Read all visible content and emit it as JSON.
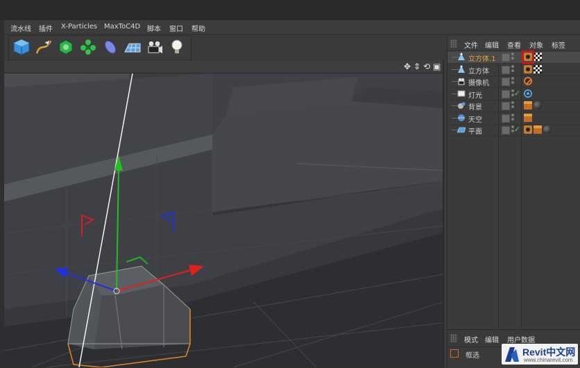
{
  "menubar": {
    "items": [
      "流水线",
      "插件",
      "X-Particles",
      "MaxToC4D",
      "脚本",
      "窗口",
      "帮助"
    ]
  },
  "toolbar": {
    "tools": [
      {
        "icon": "cube-icon"
      },
      {
        "icon": "pen-spline-icon"
      },
      {
        "icon": "subdivision-icon"
      },
      {
        "icon": "cloner-icon"
      },
      {
        "icon": "deformer-icon"
      },
      {
        "icon": "floor-grid-icon"
      },
      {
        "icon": "camera-icon"
      },
      {
        "icon": "light-bulb-icon"
      }
    ]
  },
  "viewport": {
    "controls": [
      "✥",
      "⇕",
      "⟲",
      "▣"
    ]
  },
  "object_manager": {
    "tabs": [
      "文件",
      "编辑",
      "查看",
      "对象",
      "标签"
    ],
    "objects": [
      {
        "name": "立方体.1",
        "icon": "cube-icon",
        "selected": true,
        "check": false,
        "tags": [
          "phong",
          "checker"
        ],
        "highlight": true
      },
      {
        "name": "立方体",
        "icon": "cube-icon",
        "selected": false,
        "check": false,
        "tags": [
          "phong",
          "checker"
        ],
        "highlight": false
      },
      {
        "name": "摄像机",
        "icon": "camera-icon",
        "selected": false,
        "check": false,
        "tags": [
          "protect"
        ],
        "highlight": false
      },
      {
        "name": "灯光",
        "icon": "light-icon",
        "selected": false,
        "check": true,
        "tags": [
          "target"
        ],
        "highlight": false
      },
      {
        "name": "背景",
        "icon": "background-icon",
        "selected": false,
        "check": false,
        "tags": [
          "clap",
          "sphere"
        ],
        "highlight": false
      },
      {
        "name": "天空",
        "icon": "sky-icon",
        "selected": false,
        "check": false,
        "tags": [
          "clap"
        ],
        "highlight": false
      },
      {
        "name": "平面",
        "icon": "plane-icon",
        "selected": false,
        "check": true,
        "tags": [
          "phong",
          "clap",
          "sphere"
        ],
        "highlight": false
      }
    ],
    "check_symbol": "✓"
  },
  "attribute_manager": {
    "tabs": [
      "模式",
      "编辑",
      "用户数据"
    ],
    "sub_label": "框选"
  },
  "watermark": {
    "brand": "Revit中文网",
    "url": "www.chinarevit.com"
  },
  "colors": {
    "accent_orange": "#f0a030",
    "highlight_red": "#e01010",
    "axis_y": "#22c022",
    "axis_x": "#e02020",
    "axis_z": "#2030e0"
  }
}
